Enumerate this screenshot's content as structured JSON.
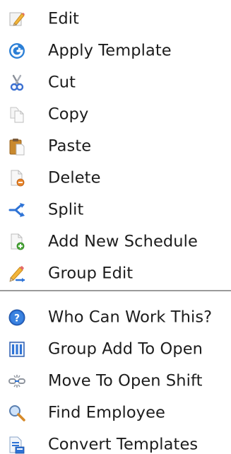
{
  "menu": {
    "items": [
      {
        "label": "Edit",
        "icon": "pencil-icon"
      },
      {
        "label": "Apply Template",
        "icon": "apply-template-icon"
      },
      {
        "label": "Cut",
        "icon": "scissors-icon"
      },
      {
        "label": "Copy",
        "icon": "copy-icon"
      },
      {
        "label": "Paste",
        "icon": "paste-icon"
      },
      {
        "label": "Delete",
        "icon": "delete-icon"
      },
      {
        "label": "Split",
        "icon": "split-icon"
      },
      {
        "label": "Add New Schedule",
        "icon": "add-schedule-icon"
      },
      {
        "label": "Group Edit",
        "icon": "group-edit-icon"
      }
    ],
    "items_after_separator": [
      {
        "label": "Who Can Work This?",
        "icon": "help-icon"
      },
      {
        "label": "Group Add To Open",
        "icon": "group-add-icon"
      },
      {
        "label": "Move To Open Shift",
        "icon": "move-shift-icon"
      },
      {
        "label": "Find Employee",
        "icon": "magnifier-icon"
      },
      {
        "label": "Convert Templates",
        "icon": "convert-templates-icon"
      }
    ]
  }
}
